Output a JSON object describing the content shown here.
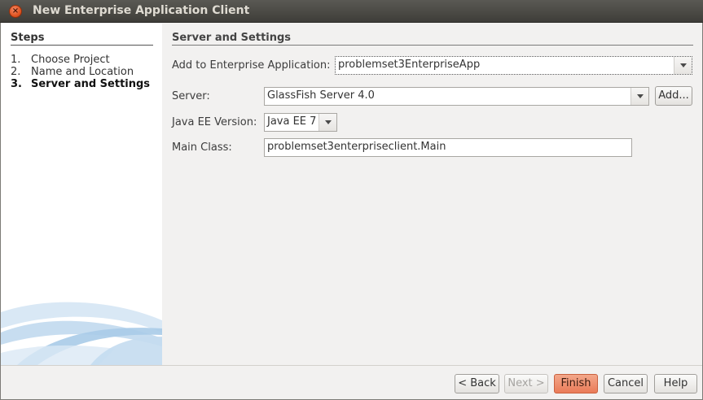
{
  "window": {
    "title": "New Enterprise Application Client",
    "close_glyph": "×"
  },
  "steps": {
    "title": "Steps",
    "items": [
      {
        "num": "1.",
        "label": "Choose Project"
      },
      {
        "num": "2.",
        "label": "Name and Location"
      },
      {
        "num": "3.",
        "label": "Server and Settings"
      }
    ]
  },
  "section": {
    "title": "Server and Settings"
  },
  "form": {
    "enterprise_app_label": "Add to Enterprise Application:",
    "enterprise_app_value": "problemset3EnterpriseApp",
    "server_label": "Server:",
    "server_value": "GlassFish Server 4.0",
    "add_label": "Add...",
    "javaee_label": "Java EE Version:",
    "javaee_value": "Java EE 7",
    "main_class_label": "Main Class:",
    "main_class_value": "problemset3enterpriseclient.Main"
  },
  "buttons": {
    "back": "< Back",
    "next": "Next >",
    "finish": "Finish",
    "cancel": "Cancel",
    "help": "Help"
  },
  "colors": {
    "accent": "#ea7b58",
    "titlebar": "#3e3d39"
  }
}
